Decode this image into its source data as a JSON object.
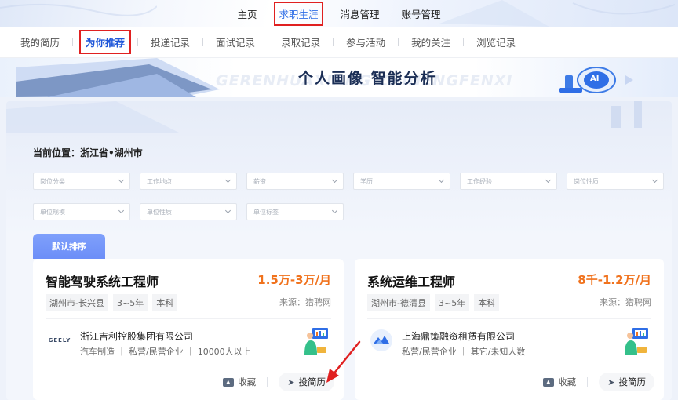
{
  "topnav": {
    "items": [
      {
        "label": "主页"
      },
      {
        "label": "求职生涯"
      },
      {
        "label": "消息管理"
      },
      {
        "label": "账号管理"
      }
    ]
  },
  "subnav": {
    "items": [
      {
        "label": "我的简历"
      },
      {
        "label": "为你推荐"
      },
      {
        "label": "投递记录"
      },
      {
        "label": "面试记录"
      },
      {
        "label": "录取记录"
      },
      {
        "label": "参与活动"
      },
      {
        "label": "我的关注"
      },
      {
        "label": "浏览记录"
      }
    ]
  },
  "banner": {
    "title": "个人画像 智能分析",
    "ghost_text": "GERENHUAXIANG ZHINENGFENXI",
    "badge": "AI"
  },
  "location": "当前位置：浙江省•湖州市",
  "filters": {
    "row1": [
      "岗位分类",
      "工作地点",
      "薪资",
      "学历",
      "工作经验",
      "岗位性质"
    ],
    "row2": [
      "单位规模",
      "单位性质",
      "单位标签"
    ]
  },
  "sort": {
    "label": "默认排序"
  },
  "jobs": [
    {
      "title": "智能驾驶系统工程师",
      "salary": "1.5万-3万/月",
      "tags": [
        "湖州市-长兴县",
        "3~5年",
        "本科"
      ],
      "source": "来源：猎聘网",
      "company": "浙江吉利控股集团有限公司",
      "company_info": "汽车制造 ｜ 私营/民营企业 ｜ 10000人以上",
      "logo": "GEELY",
      "favorite": "收藏",
      "apply": "投简历"
    },
    {
      "title": "系统运维工程师",
      "salary": "8千-1.2万/月",
      "tags": [
        "湖州市-德清县",
        "3~5年",
        "本科"
      ],
      "source": "来源：猎聘网",
      "company": "上海鼎策融资租赁有限公司",
      "company_info": "私营/民营企业 ｜ 其它/未知人数",
      "logo": "",
      "favorite": "收藏",
      "apply": "投简历"
    }
  ],
  "colors": {
    "accent": "#2f6ee6",
    "salary": "#f0721d",
    "highlight": "#e02020",
    "sort_button": "#6c8ef8"
  }
}
